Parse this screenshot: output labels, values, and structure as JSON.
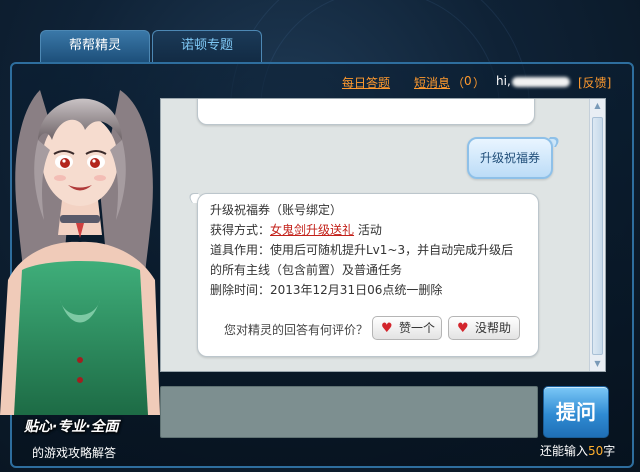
{
  "tabs": [
    {
      "label": "帮帮精灵",
      "active": true
    },
    {
      "label": "诺顿专题",
      "active": false
    }
  ],
  "header": {
    "daily_qa": "每日答题",
    "messages_label": "短消息",
    "messages_open": "（",
    "messages_count": "0",
    "messages_close": "）",
    "greeting": "hi,",
    "feedback": "[反馈]"
  },
  "chat": {
    "user_message": "升级祝福券",
    "answer": {
      "title": "升级祝福券（账号绑定）",
      "obtain_label": "获得方式：",
      "obtain_link": "女鬼剑升级送礼",
      "obtain_suffix": " 活动",
      "usage_line1": "道具作用：使用后可随机提升Lv1~3，并自动完成升级后",
      "usage_line2": "的所有主线（包含前置）及普通任务",
      "delete_time": "删除时间：2013年12月31日06点统一删除",
      "rate_question": "您对精灵的回答有何评价？",
      "like_button": "赞一个",
      "dislike_button": "没帮助"
    }
  },
  "input": {
    "value": "",
    "ask_button": "提问",
    "remaining_prefix": "还能输入",
    "remaining_count": "50",
    "remaining_suffix": "字"
  },
  "branding": {
    "slogan": "贴心·专业·全面",
    "subtitle": "的游戏攻略解答"
  },
  "colors": {
    "accent_orange": "#ff9a2e",
    "link_red": "#c3221b",
    "frame_blue": "#2e6e9e",
    "button_blue": "#2f8bd3"
  }
}
